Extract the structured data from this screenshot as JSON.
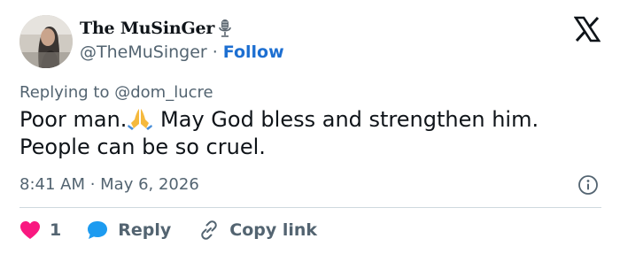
{
  "author": {
    "display_name": "The MuSinGer",
    "handle": "@TheMuSinger",
    "separator": "·",
    "follow_label": "Follow"
  },
  "reply_context": {
    "prefix": "Replying to",
    "mention": "@dom_lucre"
  },
  "tweet": {
    "text_part1": "Poor man.",
    "text_part2": " May God bless and strengthen him. People can be so cruel."
  },
  "timestamp": "8:41 AM · May 6, 2026",
  "actions": {
    "like_count": "1",
    "reply_label": "Reply",
    "copy_link_label": "Copy link"
  },
  "colors": {
    "like": "#f91880",
    "reply": "#1d9bf0",
    "follow": "#1d6fd1",
    "muted": "#536471"
  },
  "icons": [
    "microphone-icon",
    "x-logo-icon",
    "folded-hands-emoji",
    "info-icon",
    "heart-icon",
    "reply-bubble-icon",
    "link-icon"
  ]
}
